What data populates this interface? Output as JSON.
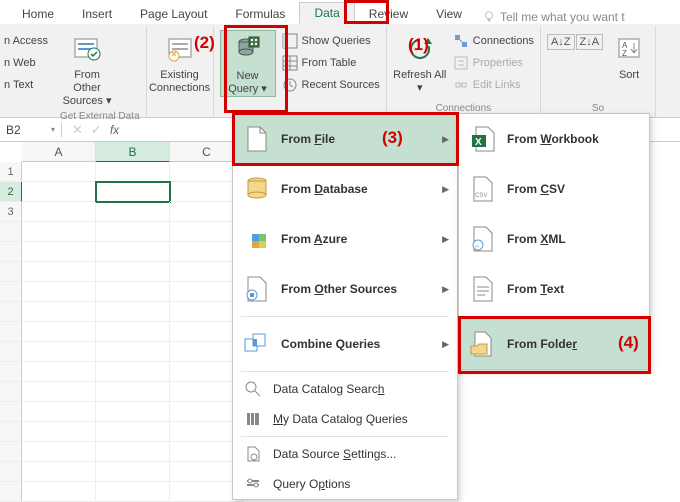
{
  "tabs": {
    "home": "Home",
    "insert": "Insert",
    "pagelayout": "Page Layout",
    "formulas": "Formulas",
    "data": "Data",
    "review": "Review",
    "view": "View",
    "tellme": "Tell me what you want t"
  },
  "ribbon": {
    "access": "n Access",
    "web": "n Web",
    "text": "n Text",
    "fromOther": "From Other Sources",
    "getExternal": "Get External Data",
    "existing": "Existing Connections",
    "newQuery": "New Query",
    "showQueries": "Show Queries",
    "fromTable": "From Table",
    "recentSources": "Recent Sources",
    "refreshAll": "Refresh All",
    "connections": "Connections",
    "properties": "Properties",
    "editLinks": "Edit Links",
    "connectionsGroup": "Connections",
    "sort": "Sort",
    "so": "So"
  },
  "namebox": "B2",
  "cols": [
    "A",
    "B",
    "C"
  ],
  "menu1": {
    "fromFile": "From File",
    "fromDatabase": "From Database",
    "fromAzure": "From Azure",
    "fromOther": "From Other Sources",
    "combine": "Combine Queries",
    "catalogSearch": "Data Catalog Search",
    "myCatalog": "My Data Catalog Queries",
    "dsSettings": "Data Source Settings...",
    "queryOptions": "Query Options"
  },
  "menu2": {
    "workbook": "From Workbook",
    "csv": "From CSV",
    "xml": "From XML",
    "text": "From Text",
    "folder": "From Folder"
  },
  "anno": {
    "a1": "(1)",
    "a2": "(2)",
    "a3": "(3)",
    "a4": "(4)"
  }
}
